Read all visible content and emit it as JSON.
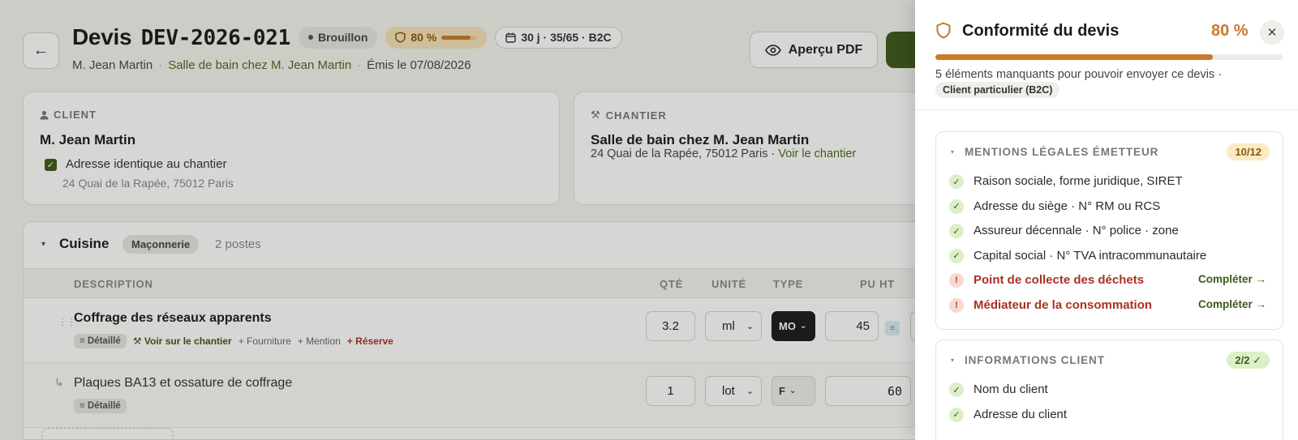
{
  "header": {
    "back_icon": "arrow-left-icon",
    "title": "Devis",
    "reference": "DEV-2026-021",
    "status": "Brouillon",
    "score": "80 %",
    "score_fraction": 0.8,
    "meta": "30 j · 35/65 · B2C",
    "client": "M. Jean Martin",
    "chantier_link": "Salle de bain chez M. Jean Martin",
    "issued": "Émis le 07/08/2026",
    "pdf_button": "Aperçu PDF"
  },
  "client_card": {
    "label": "CLIENT",
    "name": "M. Jean Martin",
    "checkbox_label": "Adresse identique au chantier",
    "address": "24 Quai de la Rapée, 75012 Paris"
  },
  "chantier_card": {
    "label": "CHANTIER",
    "name": "Salle de bain chez M. Jean Martin",
    "address": "24 Quai de la Rapée, 75012 Paris · ",
    "link": "Voir le chantier"
  },
  "section": {
    "title": "Cuisine",
    "badge": "Maçonnerie",
    "count": "2 postes",
    "columns": [
      "DESCRIPTION",
      "QTÉ",
      "UNITÉ",
      "TYPE",
      "PU HT"
    ],
    "rows": [
      {
        "description": "Coffrage des réseaux apparents",
        "tag": "≡ Détaillé",
        "link": "Voir sur le chantier",
        "plus1": "+ Fourniture",
        "plus2": "+ Mention",
        "plus3": "+ Réserve",
        "qty": "3.2",
        "unit": "ml",
        "type": "MO",
        "pu": "45"
      },
      {
        "description": "Plaques BA13 et ossature de coffrage",
        "tag": "≡ Détaillé",
        "qty": "1",
        "unit": "lot",
        "type": "F",
        "pu": "60"
      }
    ]
  },
  "panel": {
    "title": "Conformité du devis",
    "score": "80 %",
    "score_fraction": 0.8,
    "description": "5 éléments manquants pour pouvoir envoyer ce devis ·",
    "chip": "Client particulier (B2C)",
    "groups": [
      {
        "title": "MENTIONS LÉGALES ÉMETTEUR",
        "badge": "10/12",
        "items": [
          {
            "label": "Raison sociale, forme juridique, SIRET",
            "ok": true
          },
          {
            "label": "Adresse du siège · N° RM ou RCS",
            "ok": true
          },
          {
            "label": "Assureur décennale · N° police · zone",
            "ok": true
          },
          {
            "label": "Capital social · N° TVA intracommunautaire",
            "ok": true
          },
          {
            "label": "Point de collecte des déchets",
            "ok": false,
            "action": "Compléter →"
          },
          {
            "label": "Médiateur de la consommation",
            "ok": false,
            "action": "Compléter →"
          }
        ]
      },
      {
        "title": "INFORMATIONS CLIENT",
        "badge": "2/2 ✓",
        "items": [
          {
            "label": "Nom du client",
            "ok": true
          },
          {
            "label": "Adresse du client",
            "ok": true
          }
        ]
      }
    ]
  },
  "icons": {
    "ok": "✓",
    "bad": "!",
    "close": "✕",
    "caret": "▾",
    "sub": "↳",
    "drag": "⋮⋮"
  },
  "colors": {
    "accent_green": "#3e5a1a",
    "score_orange": "#c97a2a",
    "error_red": "#a83224"
  }
}
